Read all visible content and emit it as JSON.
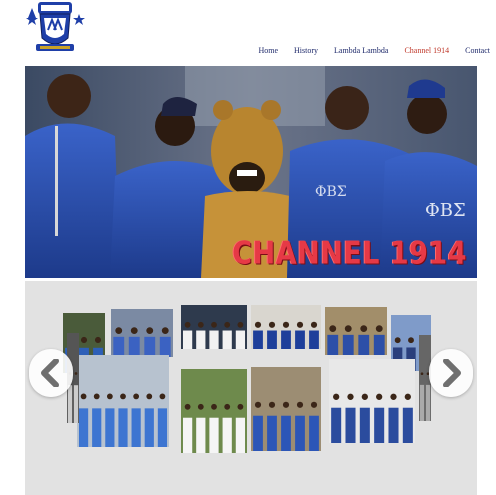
{
  "header": {
    "logo": {
      "icon": "fraternity-crest-logo",
      "colors": [
        "#1f3fa8",
        "#ffffff",
        "#c9a227"
      ]
    }
  },
  "nav": {
    "items": [
      {
        "label": "Home",
        "active": false
      },
      {
        "label": "History",
        "active": false
      },
      {
        "label": "Lambda Lambda",
        "active": false
      },
      {
        "label": "Channel 1914",
        "active": true
      },
      {
        "label": "Contact",
        "active": false
      }
    ],
    "active_color": "#c0392b",
    "color": "#1f2a6b"
  },
  "hero": {
    "caption": "CHANNEL 1914",
    "caption_color": "#e63946"
  },
  "gallery": {
    "background": "#e2e2e2",
    "prev_icon": "chevron-left-icon",
    "next_icon": "chevron-right-icon",
    "photo_count": 12
  }
}
